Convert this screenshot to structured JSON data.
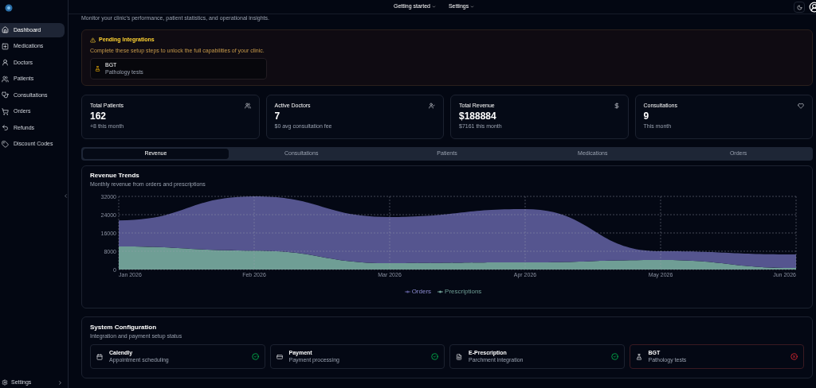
{
  "topnav": {
    "menus": [
      "Getting started",
      "Settings"
    ]
  },
  "sidebar": {
    "items": [
      {
        "label": "Dashboard",
        "selected": true
      },
      {
        "label": "Medications",
        "selected": false
      },
      {
        "label": "Doctors",
        "selected": false
      },
      {
        "label": "Patients",
        "selected": false
      },
      {
        "label": "Consultations",
        "selected": false
      },
      {
        "label": "Orders",
        "selected": false
      },
      {
        "label": "Refunds",
        "selected": false
      },
      {
        "label": "Discount Codes",
        "selected": false
      }
    ],
    "footer": "Settings"
  },
  "page": {
    "subtitle": "Monitor your clinic's performance, patient statistics, and operational insights."
  },
  "pending": {
    "title": "Pending Integrations",
    "description": "Complete these setup steps to unlock the full capabilities of your clinic.",
    "items": [
      {
        "name": "BGT",
        "description": "Pathology tests"
      }
    ]
  },
  "stats": [
    {
      "label": "Total Patients",
      "value": "162",
      "note": "+8 this month"
    },
    {
      "label": "Active Doctors",
      "value": "7",
      "note": "$0 avg consultation fee"
    },
    {
      "label": "Total Revenue",
      "value": "$188884",
      "note": "$7161 this month"
    },
    {
      "label": "Consultations",
      "value": "9",
      "note": "This month"
    }
  ],
  "tabs": [
    {
      "label": "Revenue",
      "selected": true
    },
    {
      "label": "Consultations",
      "selected": false
    },
    {
      "label": "Patients",
      "selected": false
    },
    {
      "label": "Medications",
      "selected": false
    },
    {
      "label": "Orders",
      "selected": false
    }
  ],
  "revenue_card": {
    "title": "Revenue Trends",
    "subtitle": "Monthly revenue from orders and prescriptions",
    "chart_data": {
      "type": "area",
      "stacked": true,
      "grid": true,
      "legend": true,
      "categories": [
        "Jan 2026",
        "Feb 2026",
        "Mar 2026",
        "Apr 2026",
        "May 2026",
        "Jun 2026"
      ],
      "ylim": [
        0,
        32000
      ],
      "yticks": [
        0,
        8000,
        16000,
        24000,
        32000
      ],
      "series": [
        {
          "name": "Prescriptions",
          "color": "#6f9e95",
          "values": [
            10100,
            8300,
            2800,
            3100,
            4200,
            700
          ]
        },
        {
          "name": "Orders",
          "color": "#55558f",
          "values": [
            11400,
            23700,
            20200,
            23300,
            3800,
            5900
          ]
        }
      ]
    }
  },
  "system_config": {
    "title": "System Configuration",
    "subtitle": "Integration and payment setup status",
    "items": [
      {
        "name": "Calendly",
        "description": "Appointment scheduling",
        "configured": true
      },
      {
        "name": "Payment",
        "description": "Payment processing",
        "configured": true
      },
      {
        "name": "E-Prescription",
        "description": "Parchment integration",
        "configured": true
      },
      {
        "name": "BGT",
        "description": "Pathology tests",
        "configured": false
      }
    ]
  }
}
